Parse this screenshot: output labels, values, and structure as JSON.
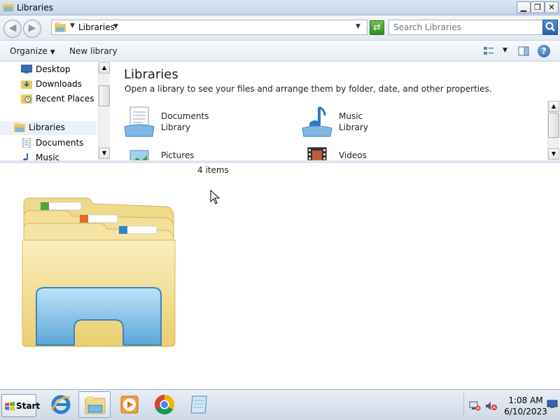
{
  "window": {
    "title": "Libraries",
    "minimize_glyph": "▁",
    "maximize_glyph": "❐",
    "close_glyph": "✕"
  },
  "address_bar": {
    "back_glyph": "◀",
    "forward_glyph": "▶",
    "crumb": "Libraries",
    "search_placeholder": "Search Libraries"
  },
  "command_bar": {
    "organize": "Organize",
    "new_library": "New library",
    "help_glyph": "?"
  },
  "nav_pane": {
    "items": [
      {
        "label": "Desktop",
        "icon": "desktop-icon"
      },
      {
        "label": "Downloads",
        "icon": "downloads-folder-icon"
      },
      {
        "label": "Recent Places",
        "icon": "recent-places-icon"
      },
      {
        "label": "Libraries",
        "icon": "libraries-icon"
      },
      {
        "label": "Documents",
        "icon": "documents-icon"
      },
      {
        "label": "Music",
        "icon": "music-icon"
      }
    ]
  },
  "content": {
    "title": "Libraries",
    "description": "Open a library to see your files and arrange them by folder, date, and other properties.",
    "libraries": [
      {
        "name": "Documents",
        "subtitle": "Library",
        "icon": "documents-library-icon"
      },
      {
        "name": "Music",
        "subtitle": "Library",
        "icon": "music-library-icon"
      },
      {
        "name": "Pictures",
        "subtitle": "",
        "icon": "pictures-library-icon"
      },
      {
        "name": "Videos",
        "subtitle": "",
        "icon": "videos-library-icon"
      }
    ]
  },
  "details": {
    "item_count": "4 items"
  },
  "taskbar": {
    "start_label": "Start",
    "pinned": [
      "internet-explorer-icon",
      "windows-explorer-icon",
      "media-player-icon",
      "chrome-icon",
      "notepad-icon"
    ],
    "clock_time": "1:08 AM",
    "clock_date": "6/10/2023"
  }
}
